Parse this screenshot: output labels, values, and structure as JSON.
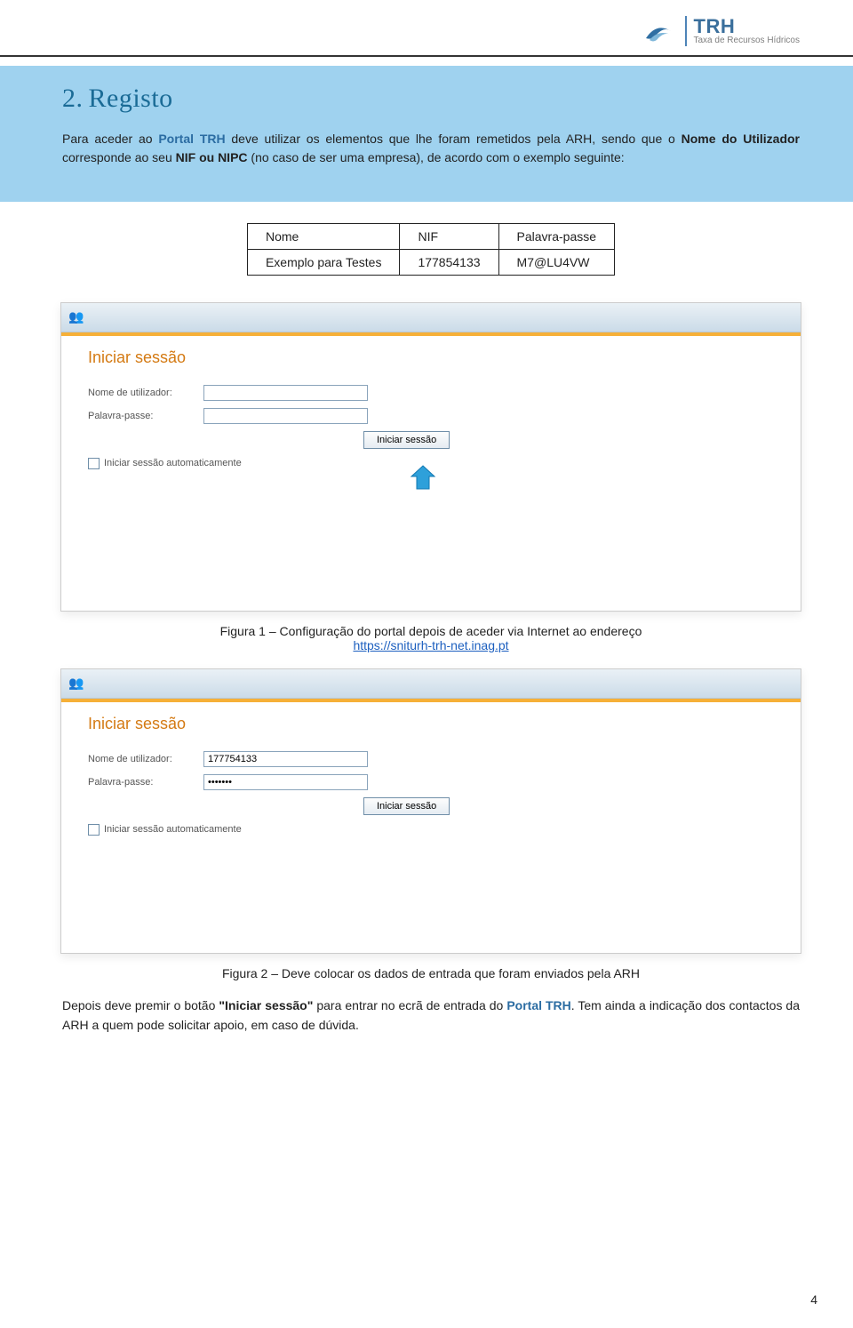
{
  "logo": {
    "abbr": "TRH",
    "sub": "Taxa de Recursos Hídricos"
  },
  "section": {
    "num": "2.",
    "title": "Registo"
  },
  "para1_parts": {
    "a": "Para aceder ao ",
    "b": "Portal TRH",
    "c": " deve utilizar os elementos que lhe foram remetidos pela ARH, sendo que o ",
    "d": "Nome do Utilizador",
    "e": " corresponde ao seu ",
    "f": "NIF ou NIPC",
    "g": " (no caso de ser uma empresa), de acordo com o exemplo seguinte:"
  },
  "example": {
    "headers": [
      "Nome",
      "NIF",
      "Palavra-passe"
    ],
    "row": [
      "Exemplo para Testes",
      "177854133",
      "M7@LU4VW"
    ]
  },
  "loginForm": {
    "title": "Iniciar sessão",
    "user_label": "Nome de utilizador:",
    "pass_label": "Palavra-passe:",
    "button": "Iniciar sessão",
    "auto": "Iniciar sessão automaticamente",
    "filled_user": "177754133",
    "filled_pass": "•••••••"
  },
  "caption1": {
    "pre": "Figura 1 – Configuração do portal depois de aceder via Internet ao endereço",
    "link": "https://sniturh-trh-net.inag.pt"
  },
  "caption2": "Figura 2 – Deve colocar os dados de entrada que foram enviados pela ARH",
  "para_last_parts": {
    "a": "Depois deve premir o botão ",
    "b": "\"Iniciar sessão\"",
    "c": " para entrar no ecrã de entrada do ",
    "d": "Portal TRH",
    "e": ". Tem ainda a indicação dos contactos da ARH a quem pode solicitar apoio, em caso de dúvida."
  },
  "pagenum": "4"
}
